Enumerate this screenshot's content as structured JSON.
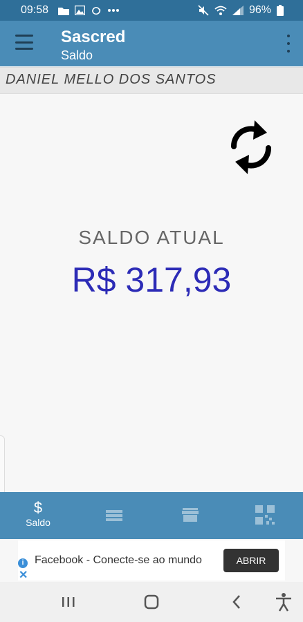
{
  "status_bar": {
    "time": "09:58",
    "battery": "96%"
  },
  "toolbar": {
    "title": "Sascred",
    "subtitle": "Saldo"
  },
  "user": {
    "name": "DANIEL MELLO DOS SANTOS"
  },
  "balance": {
    "label": "SALDO ATUAL",
    "value": "R$ 317,93",
    "color": "#2c2bb6"
  },
  "bottom_nav": {
    "items": [
      {
        "icon": "dollar-icon",
        "label": "Saldo",
        "active": true
      },
      {
        "icon": "list-icon",
        "label": "",
        "active": false
      },
      {
        "icon": "store-icon",
        "label": "",
        "active": false
      },
      {
        "icon": "qr-code-icon",
        "label": "",
        "active": false
      }
    ]
  },
  "ad": {
    "text": "Facebook - Conecte-se ao mundo",
    "button": "ABRIR"
  },
  "colors": {
    "toolbar": "#4a8cb7",
    "status_bar": "#2f6f99"
  }
}
